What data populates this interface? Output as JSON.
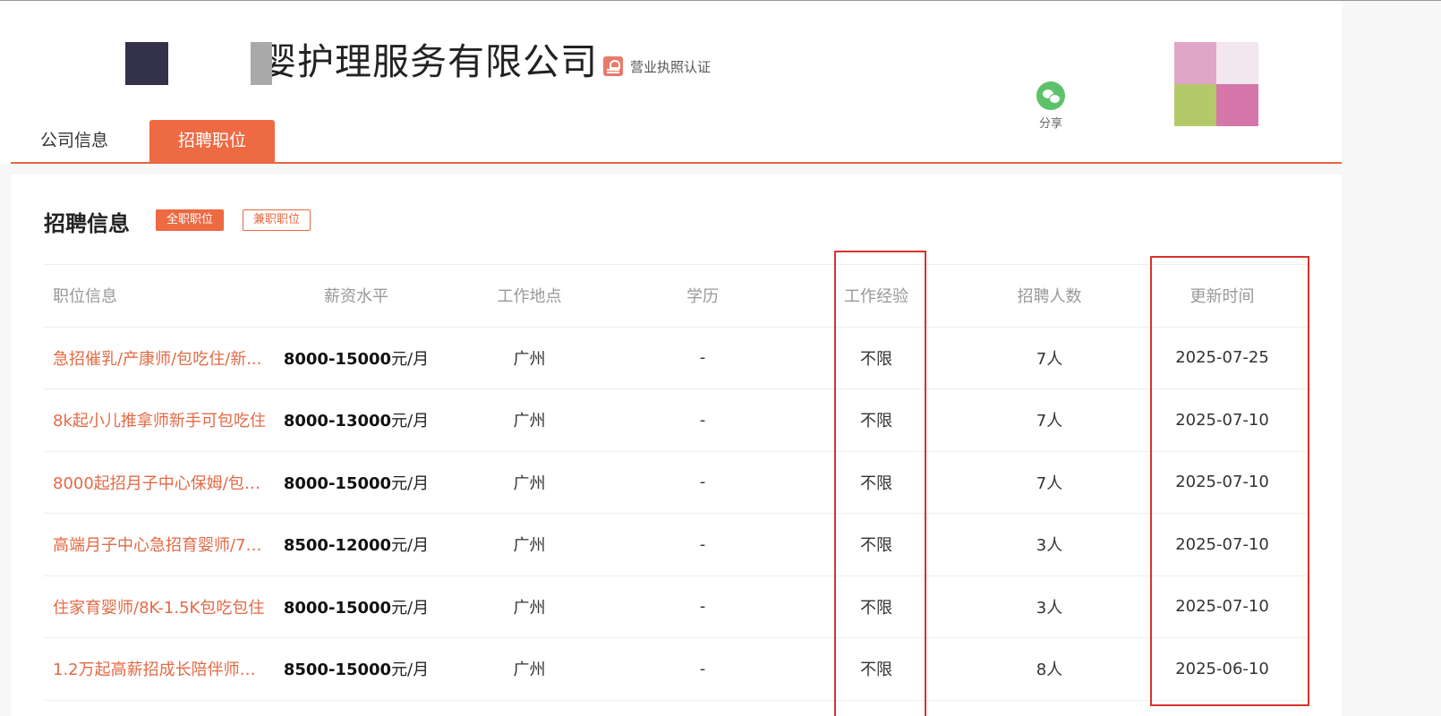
{
  "header": {
    "company_name": "婴护理服务有限公司",
    "verify_label": "营业执照认证",
    "share_label": "分享"
  },
  "nav": {
    "tabs": [
      {
        "label": "公司信息",
        "active": false
      },
      {
        "label": "招聘职位",
        "active": true
      }
    ]
  },
  "recruit": {
    "title": "招聘信息",
    "filters": [
      {
        "label": "全职职位",
        "active": true
      },
      {
        "label": "兼职职位",
        "active": false
      }
    ],
    "columns": [
      "职位信息",
      "薪资水平",
      "工作地点",
      "学历",
      "工作经验",
      "招聘人数",
      "更新时间"
    ],
    "rows": [
      {
        "title": "急招催乳/产康师/包吃住/新...",
        "salary": "8000-15000",
        "unit": "元/月",
        "location": "广州",
        "education": "-",
        "experience": "不限",
        "count": "7人",
        "updated": "2025-07-25"
      },
      {
        "title": "8k起小儿推拿师新手可包吃住",
        "salary": "8000-13000",
        "unit": "元/月",
        "location": "广州",
        "education": "-",
        "experience": "不限",
        "count": "7人",
        "updated": "2025-07-10"
      },
      {
        "title": "8000起招月子中心保姆/包吃...",
        "salary": "8000-15000",
        "unit": "元/月",
        "location": "广州",
        "education": "-",
        "experience": "不限",
        "count": "7人",
        "updated": "2025-07-10"
      },
      {
        "title": "高端月子中心急招育婴师/70...",
        "salary": "8500-12000",
        "unit": "元/月",
        "location": "广州",
        "education": "-",
        "experience": "不限",
        "count": "3人",
        "updated": "2025-07-10"
      },
      {
        "title": "住家育婴师/8K-1.5K包吃包住",
        "salary": "8000-15000",
        "unit": "元/月",
        "location": "广州",
        "education": "-",
        "experience": "不限",
        "count": "3人",
        "updated": "2025-07-10"
      },
      {
        "title": "1.2万起高薪招成长陪伴师福...",
        "salary": "8500-15000",
        "unit": "元/月",
        "location": "广州",
        "education": "-",
        "experience": "不限",
        "count": "8人",
        "updated": "2025-06-10"
      }
    ]
  },
  "colors": {
    "accent": "#ee6a43",
    "link": "#e36a45",
    "highlight": "#d9332c",
    "qr": [
      "#e0a6c8",
      "#f2e6ef",
      "#b4ca6a",
      "#d577aa"
    ]
  }
}
